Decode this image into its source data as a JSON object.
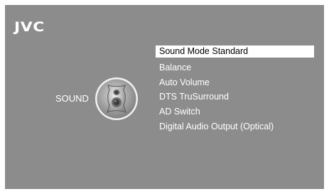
{
  "brand": {
    "logo_text": "JVC"
  },
  "section": {
    "label": "SOUND",
    "icon": "speaker-icon"
  },
  "menu": {
    "selected_index": 0,
    "items": [
      {
        "label": "Sound Mode Standard"
      },
      {
        "label": "Balance"
      },
      {
        "label": "Auto Volume"
      },
      {
        "label": "DTS TruSurround"
      },
      {
        "label": "AD Switch"
      },
      {
        "label": "Digital Audio Output (Optical)"
      }
    ]
  },
  "colors": {
    "background": "#8c8c8c",
    "text": "#ffffff",
    "highlight_bg": "#ffffff",
    "highlight_text": "#000000"
  }
}
